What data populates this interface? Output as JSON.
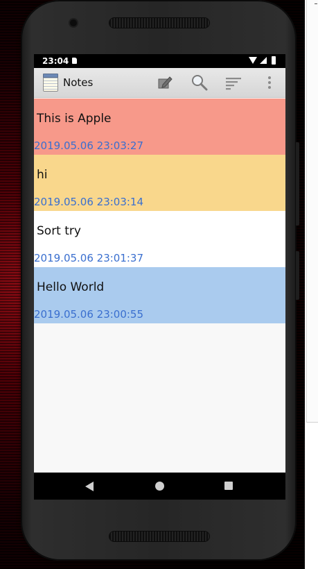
{
  "status_bar": {
    "time": "23:04"
  },
  "app_bar": {
    "title": "Notes",
    "actions": [
      "edit-icon",
      "search-icon",
      "sort-icon",
      "more-icon"
    ]
  },
  "notes": [
    {
      "title": "This is Apple",
      "date": "2019.05.06 23:03:27",
      "color": "#f7998a"
    },
    {
      "title": "hi",
      "date": "2019.05.06 23:03:14",
      "color": "#f9d78c"
    },
    {
      "title": "Sort try",
      "date": "2019.05.06 23:01:37",
      "color": "#ffffff"
    },
    {
      "title": "Hello World",
      "date": "2019.05.06 23:00:55",
      "color": "#aacbee"
    }
  ],
  "colors": {
    "date_text": "#3a6fcf",
    "app_bar": "#dcdcdc",
    "list_background": "#f8f8f8"
  }
}
